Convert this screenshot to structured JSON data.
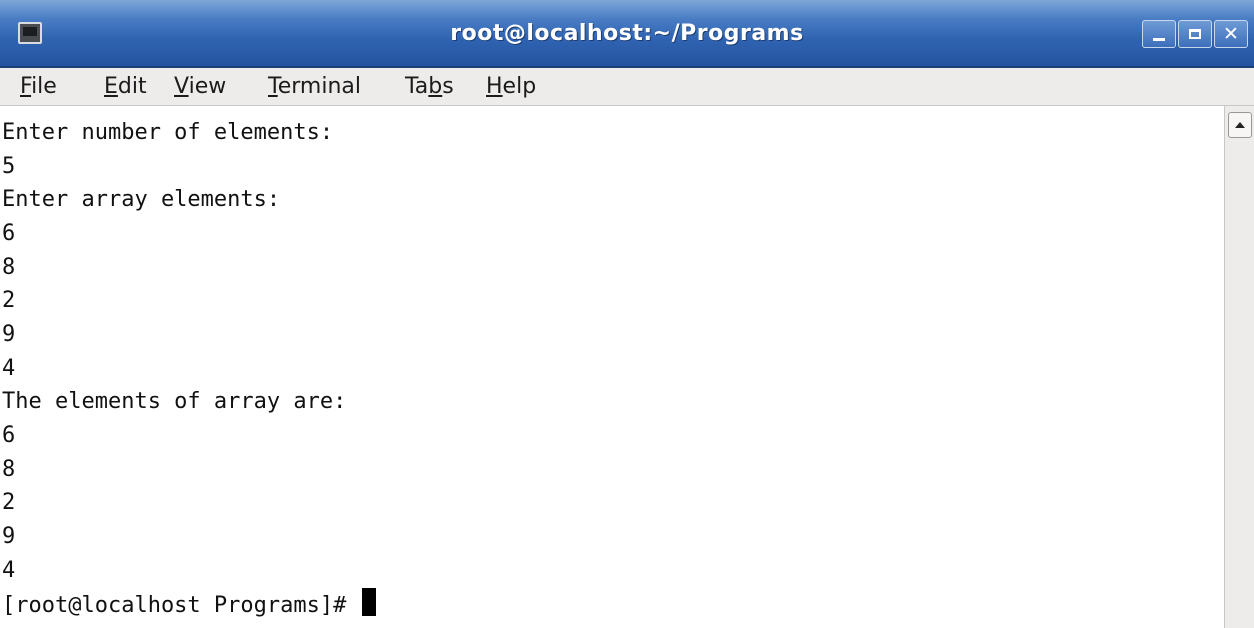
{
  "window": {
    "title": "root@localhost:~/Programs",
    "icon": "terminal-icon",
    "controls": [
      "minimize-icon",
      "maximize-icon",
      "close-icon"
    ]
  },
  "menubar": {
    "items": [
      {
        "label": "File",
        "accel": "F"
      },
      {
        "label": "Edit",
        "accel": "E"
      },
      {
        "label": "View",
        "accel": "V"
      },
      {
        "label": "Terminal",
        "accel": "T"
      },
      {
        "label": "Tabs",
        "accel": "b"
      },
      {
        "label": "Help",
        "accel": "H"
      }
    ]
  },
  "terminal": {
    "lines": [
      "Enter number of elements:",
      "5",
      "Enter array elements:",
      "6",
      "8",
      "2",
      "9",
      "4",
      "The elements of array are:",
      "6",
      "8",
      "2",
      "9",
      "4"
    ],
    "prompt": "[root@localhost Programs]# "
  },
  "scrollbar": {
    "up_icon": "chevron-up-icon"
  },
  "colors": {
    "titlebar": "#2f63b1",
    "menubar": "#edeceb",
    "terminal_bg": "#ffffff",
    "terminal_fg": "#111111"
  }
}
